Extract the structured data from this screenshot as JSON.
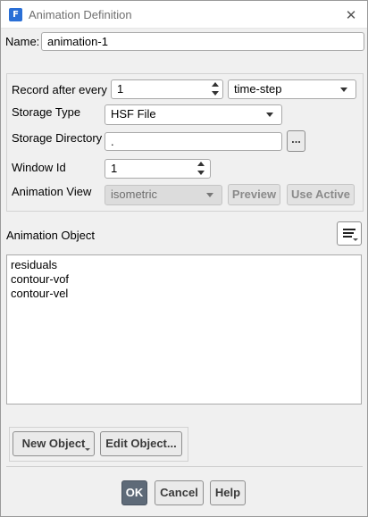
{
  "window": {
    "title": "Animation Definition",
    "app_icon_letter": "F",
    "close_glyph": "✕"
  },
  "name": {
    "label": "Name:",
    "value": "animation-1"
  },
  "record": {
    "label": "Record after every",
    "value": "1",
    "unit": "time-step"
  },
  "storage_type": {
    "label": "Storage Type",
    "value": "HSF File"
  },
  "storage_directory": {
    "label": "Storage Directory",
    "value": ".",
    "browse_label": "..."
  },
  "window_id": {
    "label": "Window Id",
    "value": "1"
  },
  "animation_view": {
    "label": "Animation View",
    "value": "isometric",
    "preview_label": "Preview",
    "use_active_label": "Use Active"
  },
  "animation_object": {
    "label": "Animation Object",
    "items": [
      "residuals",
      "contour-vof",
      "contour-vel"
    ]
  },
  "object_buttons": {
    "new_label": "New Object",
    "edit_label": "Edit Object..."
  },
  "footer": {
    "ok_label": "OK",
    "cancel_label": "Cancel",
    "help_label": "Help"
  }
}
